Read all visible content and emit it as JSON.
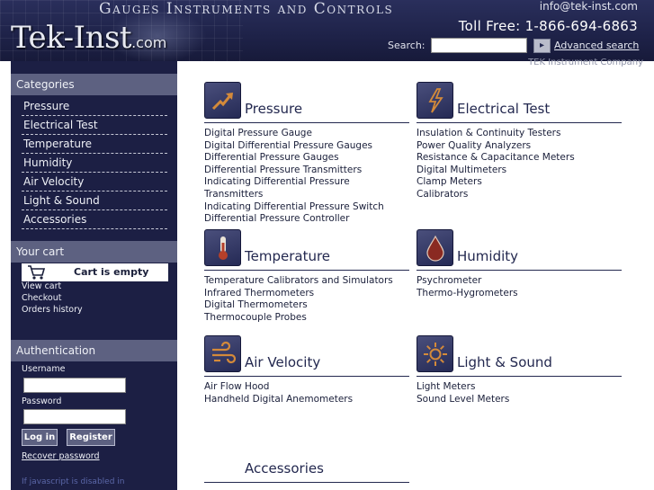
{
  "header": {
    "tagline": "Gauges Instruments and Controls",
    "logo_text": "Tek-Inst",
    "logo_domain": ".com",
    "email": "info@tek-inst.com",
    "phone": "Toll Free: 1-866-694-6863",
    "search_label": "Search:",
    "search_value": "",
    "search_go_glyph": "▸",
    "advanced_search": "Advanced search",
    "company": "TEK Instrument Company"
  },
  "sidebar": {
    "categories_title": "Categories",
    "categories": [
      {
        "label": "Pressure"
      },
      {
        "label": "Electrical Test"
      },
      {
        "label": "Temperature"
      },
      {
        "label": "Humidity"
      },
      {
        "label": "Air Velocity"
      },
      {
        "label": "Light & Sound"
      },
      {
        "label": "Accessories"
      }
    ],
    "cart_title": "Your cart",
    "cart_status": "Cart is empty",
    "cart_links": {
      "view_cart": "View cart",
      "checkout": "Checkout",
      "orders_history": "Orders history"
    },
    "auth_title": "Authentication",
    "username_label": "Username",
    "password_label": "Password",
    "login_button": "Log in",
    "register_button": "Register",
    "recover_password": "Recover password",
    "js_note": "If javascript is disabled in"
  },
  "main": {
    "categories": [
      {
        "title": "Pressure",
        "icon": "gauge-arrow-icon",
        "items": [
          "Digital Pressure Gauge",
          "Digital Differential Pressure Gauges",
          "Differential Pressure Gauges",
          "Differential Pressure Transmitters",
          "Indicating Differential Pressure Transmitters",
          "Indicating Differential Pressure Switch",
          "Differential Pressure Controller"
        ]
      },
      {
        "title": "Electrical Test",
        "icon": "lightning-bolt-icon",
        "items": [
          "Insulation & Continuity Testers",
          "Power Quality Analyzers",
          "Resistance & Capacitance Meters",
          "Digital Multimeters",
          "Clamp Meters",
          "Calibrators"
        ]
      },
      {
        "title": "Temperature",
        "icon": "thermometer-icon",
        "items": [
          "Temperature Calibrators and Simulators",
          "Infrared Thermometers",
          "Digital Thermometers",
          "Thermocouple Probes"
        ]
      },
      {
        "title": "Humidity",
        "icon": "water-drop-icon",
        "items": [
          "Psychrometer",
          "Thermo-Hygrometers"
        ]
      },
      {
        "title": "Air Velocity",
        "icon": "wind-icon",
        "items": [
          "Air Flow Hood",
          "Handheld Digital Anemometers"
        ]
      },
      {
        "title": "Light & Sound",
        "icon": "sun-icon",
        "items": [
          "Light Meters",
          "Sound Level Meters"
        ]
      },
      {
        "title": "Accessories",
        "icon": "",
        "items": []
      }
    ]
  }
}
